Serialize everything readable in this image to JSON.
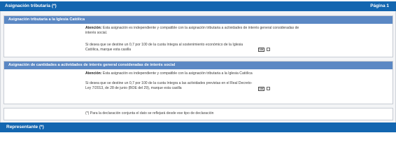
{
  "header": {
    "title": "Asignación tributaria (*)",
    "page": "Página 1"
  },
  "sections": {
    "church": {
      "title": "Asignación tributaria a la Iglesia Católica",
      "attention_label": "Atención:",
      "attention_text": " Esta asignación es independiente y compatible con la asignación tributaria a actividades de interés general consideradas de interés social.",
      "question": "Si desea que se destine un 0,7 por 100 de la cuota íntegra al sostenimiento económico de la Iglesia Católica, marque esta casilla",
      "box_code": "105"
    },
    "social": {
      "title": "Asignación de cantidades a actividades de interés general consideradas de interés social",
      "attention_label": "Atención:",
      "attention_text": " Esta asignación es independiente y compatible con la asignación tributaria a la Iglesia Católica",
      "question": "Si desea que se destine un 0,7 por 100 de la cuota íntegra a las actividades previstas en el Real Decreto-Ley 7/2013, de 28 de junio (BOE del 29), marque esta casilla",
      "box_code": "106"
    },
    "footnote": "(*) Para la declaración conjunta el dato se reflejará desde ese tipo de declaración"
  },
  "footer_bar": {
    "title": "Representante (*)"
  }
}
